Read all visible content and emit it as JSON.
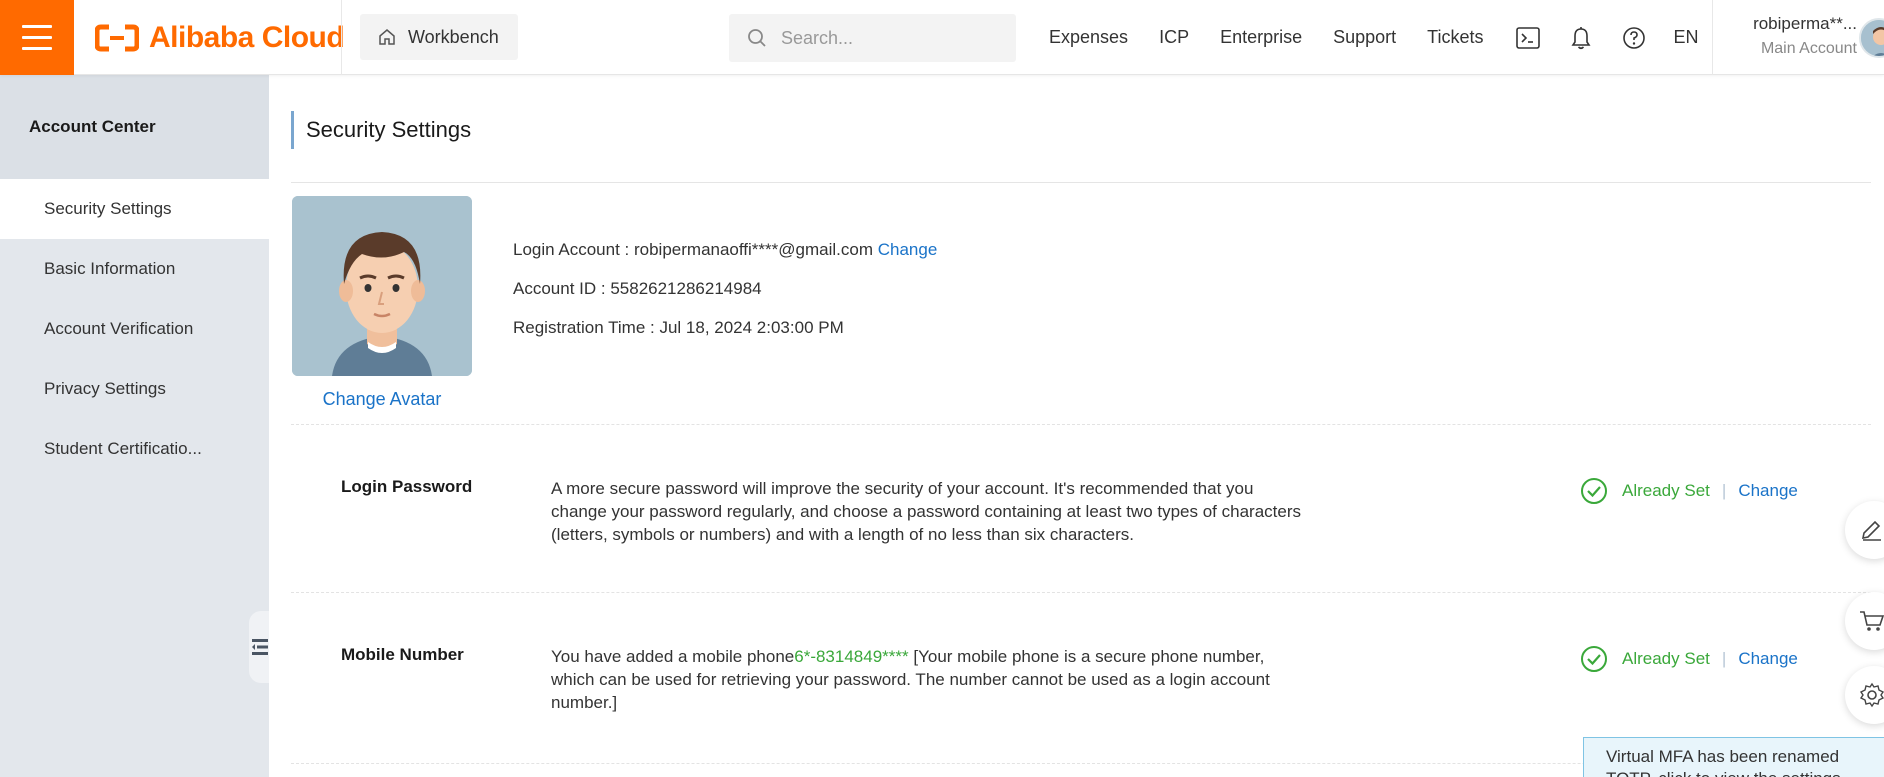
{
  "header": {
    "logo_text": "Alibaba Cloud",
    "workbench_label": "Workbench",
    "search_placeholder": "Search...",
    "nav": [
      "Expenses",
      "ICP",
      "Enterprise",
      "Support",
      "Tickets"
    ],
    "lang": "EN",
    "user_name": "robiperma**...",
    "user_role": "Main Account",
    "accent_color": "#ff6a00"
  },
  "sidebar": {
    "title": "Account Center",
    "items": [
      {
        "label": "Security Settings",
        "active": true
      },
      {
        "label": "Basic Information",
        "active": false
      },
      {
        "label": "Account Verification",
        "active": false
      },
      {
        "label": "Privacy Settings",
        "active": false
      },
      {
        "label": "Student Certificatio...",
        "active": false
      }
    ]
  },
  "main": {
    "title": "Security Settings",
    "change_avatar": "Change Avatar",
    "account": {
      "login_label": "Login Account : ",
      "login_value": "robipermanaoffi****@gmail.com",
      "login_change": "Change",
      "id_label": "Account ID : ",
      "id_value": "5582621286214984",
      "reg_label": "Registration Time : ",
      "reg_value": "Jul 18, 2024 2:03:00 PM"
    },
    "rows": [
      {
        "label": "Login Password",
        "desc": "A more secure password will improve the security of your account. It's recommended that you change your password regularly, and choose a password containing at least two types of characters (letters, symbols or numbers) and with a length of no less than six characters.",
        "status": "Already Set",
        "action": "Change"
      },
      {
        "label": "Mobile Number",
        "desc_prefix": "You have added a mobile phone",
        "desc_phone": "6*-8314849****",
        "desc_suffix": " [Your mobile phone is a secure phone number, which can be used for retrieving your password. The number cannot be used as a login account number.]",
        "status": "Already Set",
        "action": "Change"
      }
    ],
    "toast": "Virtual MFA has been renamed TOTP, click to view the settings"
  },
  "colors": {
    "link": "#1a73c8",
    "success": "#3aa83a",
    "sidebar_bg": "#e3e7ec"
  }
}
